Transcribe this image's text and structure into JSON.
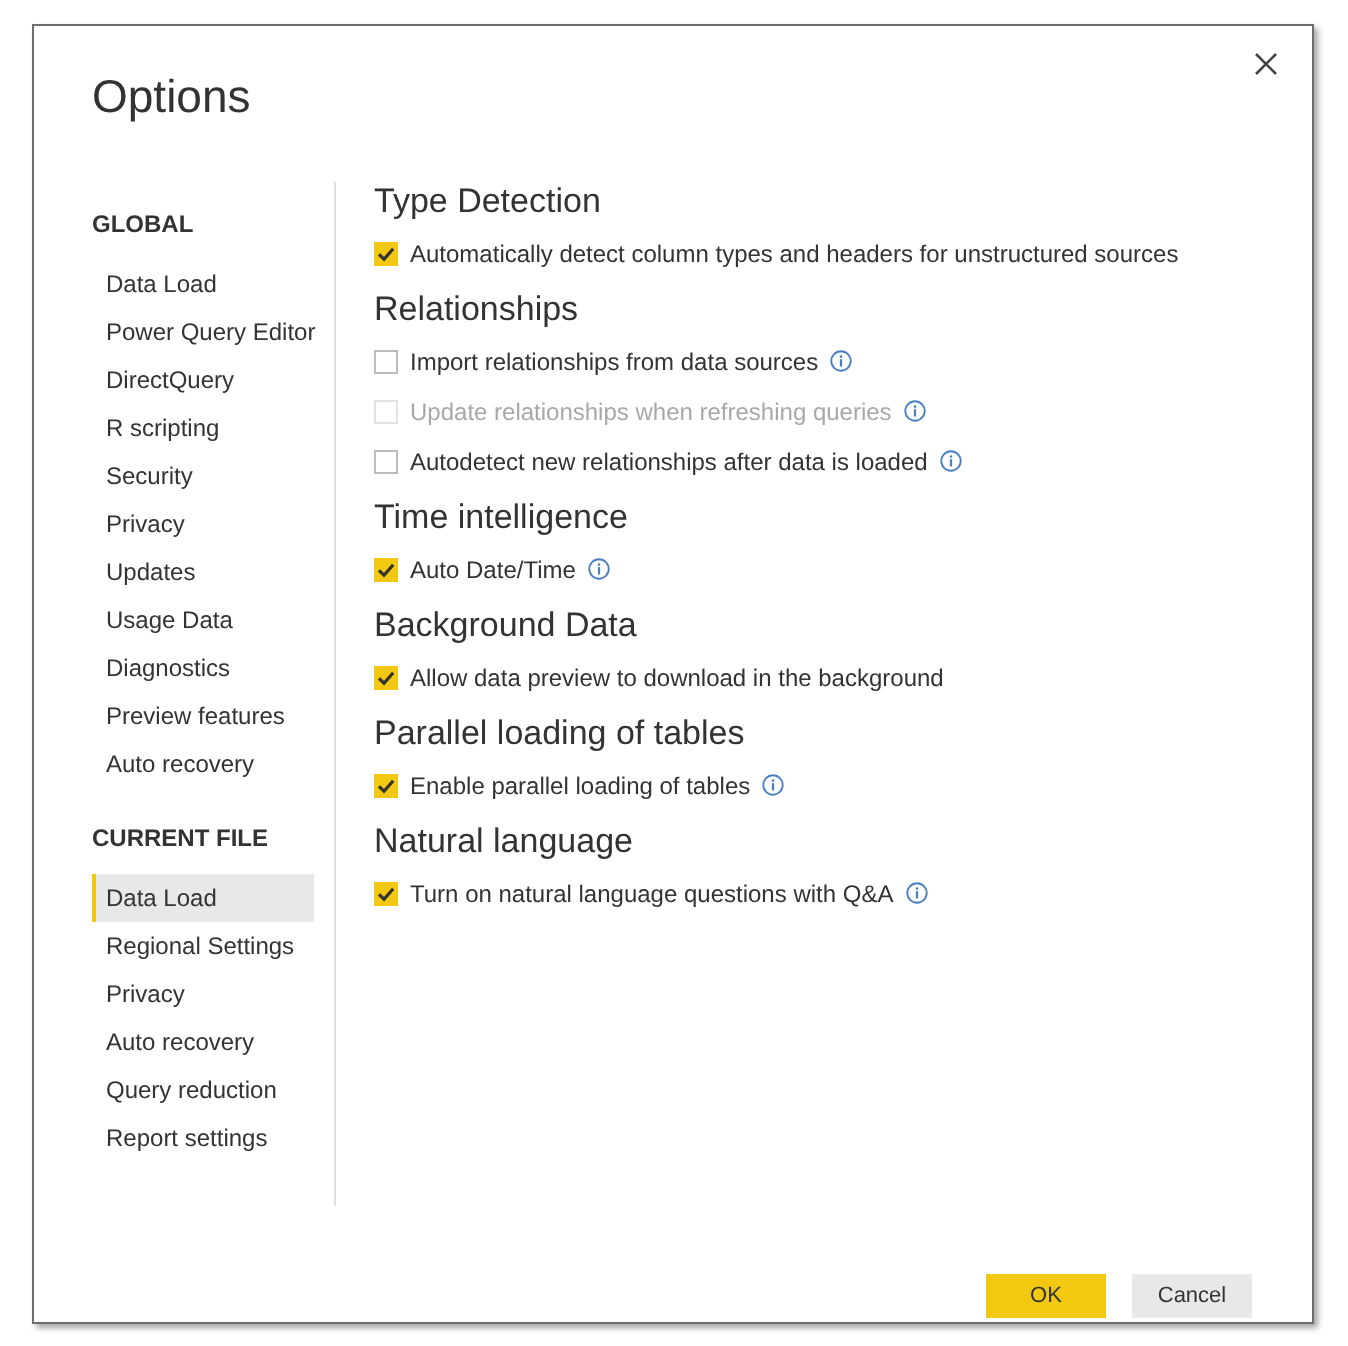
{
  "dialog": {
    "title": "Options"
  },
  "sidebar": {
    "groups": [
      {
        "heading": "GLOBAL",
        "items": [
          {
            "label": "Data Load",
            "selected": false
          },
          {
            "label": "Power Query Editor",
            "selected": false
          },
          {
            "label": "DirectQuery",
            "selected": false
          },
          {
            "label": "R scripting",
            "selected": false
          },
          {
            "label": "Security",
            "selected": false
          },
          {
            "label": "Privacy",
            "selected": false
          },
          {
            "label": "Updates",
            "selected": false
          },
          {
            "label": "Usage Data",
            "selected": false
          },
          {
            "label": "Diagnostics",
            "selected": false
          },
          {
            "label": "Preview features",
            "selected": false
          },
          {
            "label": "Auto recovery",
            "selected": false
          }
        ]
      },
      {
        "heading": "CURRENT FILE",
        "items": [
          {
            "label": "Data Load",
            "selected": true
          },
          {
            "label": "Regional Settings",
            "selected": false
          },
          {
            "label": "Privacy",
            "selected": false
          },
          {
            "label": "Auto recovery",
            "selected": false
          },
          {
            "label": "Query reduction",
            "selected": false
          },
          {
            "label": "Report settings",
            "selected": false
          }
        ]
      }
    ]
  },
  "sections": [
    {
      "title": "Type Detection",
      "options": [
        {
          "label": "Automatically detect column types and headers for unstructured sources",
          "checked": true,
          "disabled": false,
          "info": false
        }
      ]
    },
    {
      "title": "Relationships",
      "options": [
        {
          "label": "Import relationships from data sources",
          "checked": false,
          "disabled": false,
          "info": true
        },
        {
          "label": "Update relationships when refreshing queries",
          "checked": false,
          "disabled": true,
          "info": true
        },
        {
          "label": "Autodetect new relationships after data is loaded",
          "checked": false,
          "disabled": false,
          "info": true
        }
      ]
    },
    {
      "title": "Time intelligence",
      "options": [
        {
          "label": "Auto Date/Time",
          "checked": true,
          "disabled": false,
          "info": true
        }
      ]
    },
    {
      "title": "Background Data",
      "options": [
        {
          "label": "Allow data preview to download in the background",
          "checked": true,
          "disabled": false,
          "info": false
        }
      ]
    },
    {
      "title": "Parallel loading of tables",
      "options": [
        {
          "label": "Enable parallel loading of tables",
          "checked": true,
          "disabled": false,
          "info": true
        }
      ]
    },
    {
      "title": "Natural language",
      "options": [
        {
          "label": "Turn on natural language questions with Q&A",
          "checked": true,
          "disabled": false,
          "info": true
        }
      ]
    }
  ],
  "buttons": [
    {
      "label": "OK",
      "kind": "primary"
    },
    {
      "label": "Cancel",
      "kind": "secondary"
    }
  ]
}
